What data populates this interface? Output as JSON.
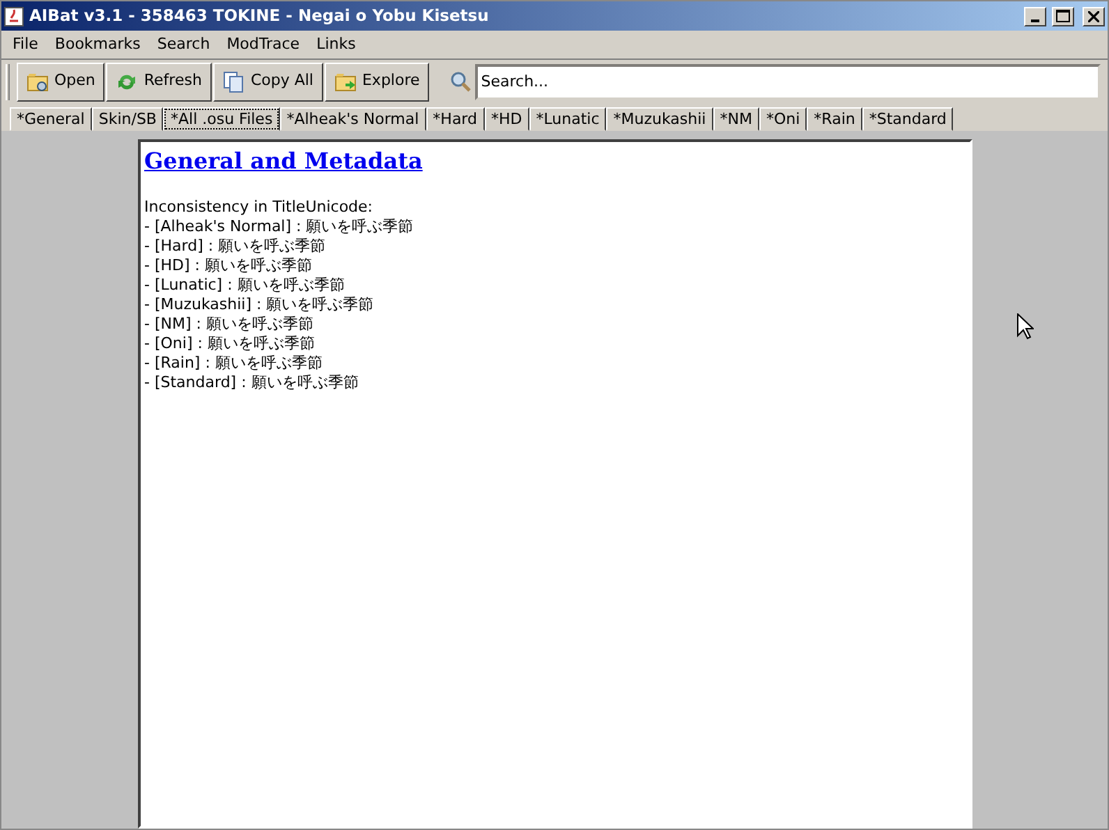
{
  "window": {
    "title": "AIBat v3.1 - 358463 TOKINE - Negai o Yobu Kisetsu"
  },
  "menu": [
    "File",
    "Bookmarks",
    "Search",
    "ModTrace",
    "Links"
  ],
  "toolbar": {
    "buttons": [
      {
        "label": "Open",
        "kind": "open"
      },
      {
        "label": "Refresh",
        "kind": "refresh"
      },
      {
        "label": "Copy All",
        "kind": "copy"
      },
      {
        "label": "Explore",
        "kind": "explore"
      }
    ],
    "search": {
      "value": "Search..."
    }
  },
  "tabs": [
    {
      "label": "*General",
      "selected": false
    },
    {
      "label": "Skin/SB",
      "selected": false
    },
    {
      "label": "*All .osu Files",
      "selected": true
    },
    {
      "label": "*Alheak's Normal",
      "selected": false
    },
    {
      "label": "*Hard",
      "selected": false
    },
    {
      "label": "*HD",
      "selected": false
    },
    {
      "label": "*Lunatic",
      "selected": false
    },
    {
      "label": "*Muzukashii",
      "selected": false
    },
    {
      "label": "*NM",
      "selected": false
    },
    {
      "label": "*Oni",
      "selected": false
    },
    {
      "label": "*Rain",
      "selected": false
    },
    {
      "label": "*Standard",
      "selected": false
    }
  ],
  "content": {
    "heading": "General and Metadata",
    "intro": "Inconsistency in TitleUnicode:",
    "lines": [
      "- [Alheak's Normal] : 願いを呼ぶ季節",
      "- [Hard] : 願いを呼ぶ季節",
      "- [HD] : 願いを呼ぶ季節",
      "- [Lunatic] : 願いを呼ぶ季節",
      "- [Muzukashii] : 願いを呼ぶ季節",
      "- [NM] : 願いを呼ぶ季節",
      "- [Oni] : 願いを呼ぶ季節",
      "- [Rain] : 願いを呼ぶ季節",
      "- [Standard] : 願いを呼ぶ季節"
    ]
  }
}
